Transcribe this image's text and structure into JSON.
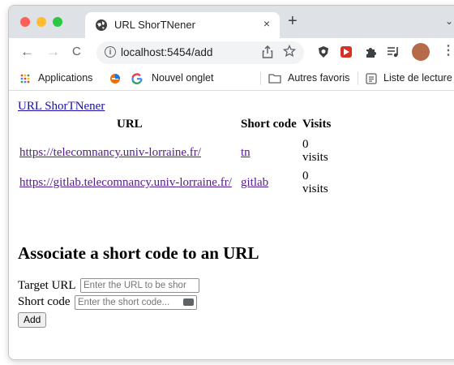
{
  "browser": {
    "tab": {
      "title": "URL ShorTNener",
      "close_glyph": "×"
    },
    "new_tab_glyph": "+",
    "tab_menu_glyph": "⌄",
    "nav": {
      "back": "←",
      "forward": "→",
      "reload": "C"
    },
    "address": {
      "info_glyph": "i",
      "url": "localhost:5454/add"
    },
    "bookmarks": {
      "apps": "Applications",
      "new_tab_label": "Nouvel onglet",
      "other_favorites": "Autres favoris",
      "reading_list": "Liste de lecture"
    }
  },
  "page": {
    "home_link": "URL ShorTNener",
    "table": {
      "headers": {
        "url": "URL",
        "short_code": "Short code",
        "visits": "Visits"
      },
      "rows": [
        {
          "url": "https://telecomnancy.univ-lorraine.fr/",
          "short_code": "tn",
          "visits_count": "0",
          "visits_unit": "visits"
        },
        {
          "url": "https://gitlab.telecomnancy.univ-lorraine.fr/",
          "short_code": "gitlab",
          "visits_count": "0",
          "visits_unit": "visits"
        }
      ]
    },
    "form": {
      "title": "Associate a short code to an URL",
      "target_url_label": "Target URL",
      "target_url_placeholder": "Enter the URL to be shor",
      "short_code_label": "Short code",
      "short_code_placeholder": "Enter the short code...",
      "submit_label": "Add"
    }
  }
}
